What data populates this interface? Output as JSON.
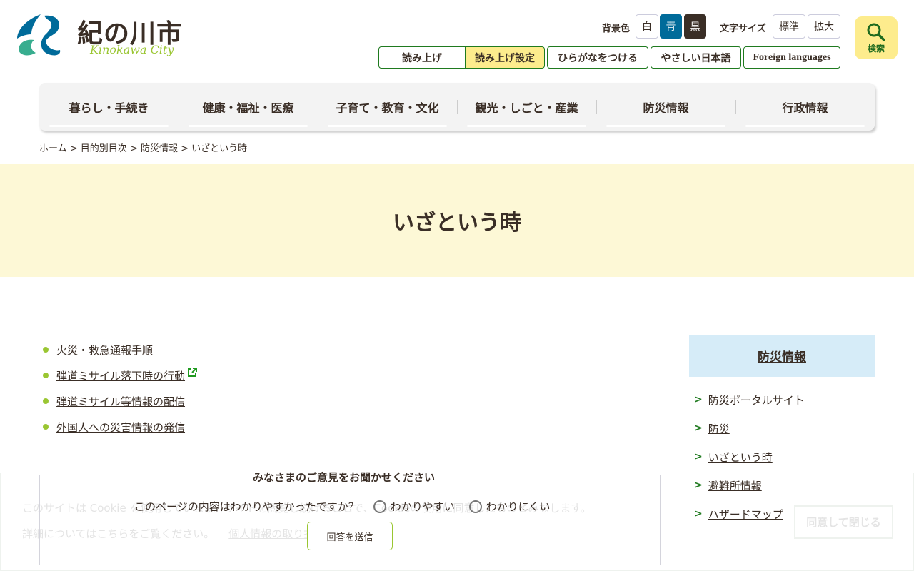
{
  "header": {
    "logo_text": "紀の川市",
    "logo_sub": "Kinokawa City",
    "bg_label": "背景色",
    "bg_options": [
      "白",
      "青",
      "黒"
    ],
    "font_label": "文字サイズ",
    "font_options": [
      "標準",
      "拡大"
    ],
    "tools": [
      "読み上げ",
      "読み上げ設定",
      "ひらがなをつける",
      "やさしい日本語",
      "Foreign languages"
    ],
    "search_label": "検索",
    "colors": {
      "accent": "#1f7a1f",
      "blue": "#006b9a",
      "black": "#3a2e26",
      "yellow": "#fdec8d"
    }
  },
  "nav": [
    "暮らし・手続き",
    "健康・福祉・医療",
    "子育て・教育・文化",
    "観光・しごと・産業",
    "防災情報",
    "行政情報"
  ],
  "breadcrumb": [
    "ホーム",
    "目的別目次",
    "防災情報",
    "いざという時"
  ],
  "breadcrumb_sep": " > ",
  "page_title": "いざという時",
  "links": [
    "火災・救急通報手順",
    "弾道ミサイル落下時の行動",
    "弾道ミサイル等情報の配信",
    "外国人への災害情報の発信"
  ],
  "sidebar": {
    "title": "防災情報",
    "items": [
      "防災ポータルサイト",
      "防災",
      "いざという時",
      "避難所情報",
      "ハザードマップ"
    ]
  },
  "cookie": {
    "text": "このサイトは Cookie を使用しています。サイトを閲覧し続けることで、Cookieの使用に同意したものとみなします。",
    "detail": "詳細についてはこちらをご覧ください。",
    "link": "個人情報の取り扱い",
    "agree": "同意して閉じる"
  },
  "survey": {
    "title": "みなさまのご意見をお聞かせください",
    "question": "このページの内容はわかりやすかったですか？",
    "options": [
      "わかりやすい",
      "わかりにくい"
    ],
    "submit": "回答を送信"
  }
}
